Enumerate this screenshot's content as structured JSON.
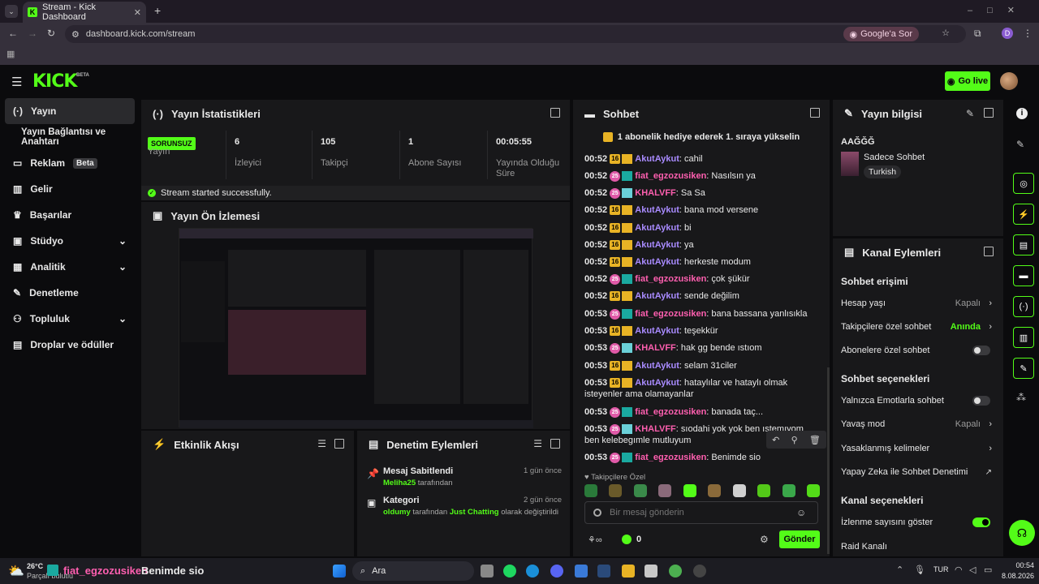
{
  "browser": {
    "tab_title": "Stream - Kick Dashboard",
    "url": "dashboard.kick.com/stream",
    "google_sor": "Google'a Sor",
    "profile_letter": "D"
  },
  "header": {
    "logo": "KICK",
    "logo_beta": "BETA",
    "go_live": "Go live"
  },
  "sidebar": {
    "items": [
      {
        "label": "Yayın"
      },
      {
        "label": "Yayın Bağlantısı ve Anahtarı"
      },
      {
        "label": "Reklam",
        "badge": "Beta"
      },
      {
        "label": "Gelir"
      },
      {
        "label": "Başarılar"
      },
      {
        "label": "Stüdyo"
      },
      {
        "label": "Analitik"
      },
      {
        "label": "Denetleme"
      },
      {
        "label": "Topluluk"
      },
      {
        "label": "Droplar ve ödüller"
      }
    ]
  },
  "stats": {
    "title": "Yayın İstatistikleri",
    "status_badge": "SORUNSUZ",
    "status_label": "Yayın",
    "cells": [
      {
        "value": "6",
        "label": "İzleyici"
      },
      {
        "value": "105",
        "label": "Takipçi"
      },
      {
        "value": "1",
        "label": "Abone Sayısı"
      },
      {
        "value": "00:05:55",
        "label": "Yayında Olduğu Süre"
      }
    ],
    "success": "Stream started successfully."
  },
  "preview": {
    "title": "Yayın Ön İzlemesi"
  },
  "activity": {
    "title": "Etkinlik Akışı"
  },
  "moderation": {
    "title": "Denetim Eylemleri",
    "items": [
      {
        "title": "Mesaj Sabitlendi",
        "user": "Meliha25",
        "suffix": "tarafından",
        "time": "1 gün önce"
      },
      {
        "title": "Kategori",
        "user": "oldumy",
        "mid": "tarafından",
        "category": "Just Chatting",
        "suffix": "olarak değiştirildi",
        "time": "2 gün önce"
      }
    ]
  },
  "chat": {
    "title": "Sohbet",
    "gift_banner": "1 abonelik hediye ederek 1. sıraya yükselin",
    "messages": [
      {
        "time": "00:52",
        "badge": "16",
        "user": "AkutAykut",
        "text": ": cahil",
        "color": "purple"
      },
      {
        "time": "00:52",
        "badge": "25",
        "user": "fiat_egzozusiken",
        "text": ": Nasılsın ya",
        "color": "pink"
      },
      {
        "time": "00:52",
        "badge": "25",
        "user": "KHALVFF",
        "text": ": Sa Sa",
        "color": "pink"
      },
      {
        "time": "00:52",
        "badge": "16",
        "user": "AkutAykut",
        "text": ": bana mod versene",
        "color": "purple"
      },
      {
        "time": "00:52",
        "badge": "16",
        "user": "AkutAykut",
        "text": ": bi",
        "color": "purple"
      },
      {
        "time": "00:52",
        "badge": "16",
        "user": "AkutAykut",
        "text": ": ya",
        "color": "purple"
      },
      {
        "time": "00:52",
        "badge": "16",
        "user": "AkutAykut",
        "text": ": herkeste modum",
        "color": "purple"
      },
      {
        "time": "00:52",
        "badge": "25",
        "user": "fiat_egzozusiken",
        "text": ": çok şükür",
        "color": "pink"
      },
      {
        "time": "00:52",
        "badge": "16",
        "user": "AkutAykut",
        "text": ": sende değilim",
        "color": "purple"
      },
      {
        "time": "00:53",
        "badge": "25",
        "user": "fiat_egzozusiken",
        "text": ": bana bassana yanlısıkla",
        "color": "pink"
      },
      {
        "time": "00:53",
        "badge": "16",
        "user": "AkutAykut",
        "text": ": teşekkür",
        "color": "purple"
      },
      {
        "time": "00:53",
        "badge": "25",
        "user": "KHALVFF",
        "text": ": hak gg bende ıstıom",
        "color": "pink"
      },
      {
        "time": "00:53",
        "badge": "16",
        "user": "AkutAykut",
        "text": ": selam 31ciler",
        "color": "purple"
      },
      {
        "time": "00:53",
        "badge": "16",
        "user": "AkutAykut",
        "text": ": hataylılar ve hataylı olmak isteyenler ama olamayanlar",
        "color": "purple"
      },
      {
        "time": "00:53",
        "badge": "25",
        "user": "fiat_egzozusiken",
        "text": ": banada taç...",
        "color": "pink"
      },
      {
        "time": "00:53",
        "badge": "25",
        "user": "KHALVFF",
        "text": ": sıodahi yok yok ben ıstemıyom ben kelebegımle mutluyum",
        "color": "pink"
      },
      {
        "time": "00:53",
        "badge": "25",
        "user": "fiat_egzozusiken",
        "text": ": Benimde sio",
        "color": "pink"
      }
    ],
    "followers_only": "Takipçilere Özel",
    "input_placeholder": "Bir mesaj gönderin",
    "count": "0",
    "send": "Gönder"
  },
  "info": {
    "title": "Yayın bilgisi",
    "stream_title": "AAĞĞĞ",
    "category": "Sadece Sohbet",
    "tag": "Turkish"
  },
  "channel": {
    "title": "Kanal Eylemleri",
    "sec1": "Sohbet erişimi",
    "hesap": "Hesap yaşı",
    "hesap_val": "Kapalı",
    "takip": "Takipçilere özel sohbet",
    "takip_val": "Anında",
    "abone": "Abonelere özel sohbet",
    "sec2": "Sohbet seçenekleri",
    "emote": "Yalnızca Emotlarla sohbet",
    "yavas": "Yavaş mod",
    "yavas_val": "Kapalı",
    "yasak": "Yasaklanmış kelimeler",
    "yapay": "Yapay Zeka ile Sohbet Denetimi",
    "sec3": "Kanal seçenekleri",
    "izlenme": "İzlenme sayısını göster",
    "raid": "Raid Kanalı"
  },
  "taskbar": {
    "weather_temp": "26°C",
    "weather_desc": "Parçalı bulutlu",
    "notif_user": "fiat_egzozusiken",
    "notif_text": "Benimde sio",
    "search": "Ara",
    "lang": "TUR",
    "time": "00:54",
    "date": "8.08.2026"
  },
  "colors": {
    "accent": "#53fc18",
    "panel": "#18181a"
  }
}
